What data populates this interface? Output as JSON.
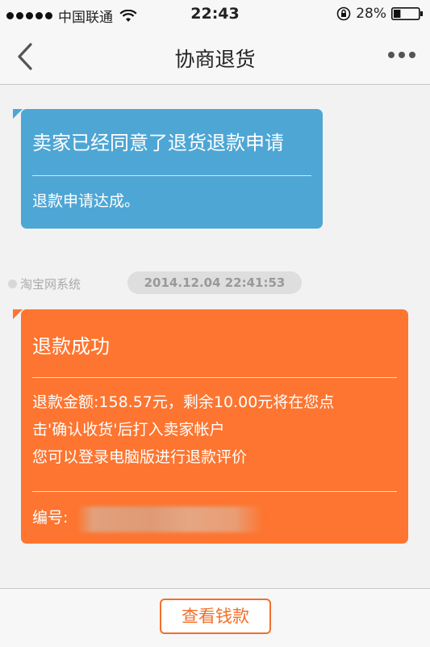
{
  "status_bar": {
    "carrier": "中国联通",
    "time": "22:43",
    "battery_percent": "28%",
    "battery_level": 0.28,
    "icons": [
      "signal-dots-icon",
      "wifi-icon",
      "rotation-lock-icon",
      "battery-icon"
    ]
  },
  "nav": {
    "title": "协商退货",
    "icons": [
      "back-chevron-icon",
      "more-icon"
    ]
  },
  "messages": [
    {
      "title": "卖家已经同意了退货退款申请",
      "lines": [
        "退款申请达成。"
      ],
      "color": "#4ea6d5"
    },
    {
      "sender": "淘宝网系统",
      "timestamp": "2014.12.04 22:41:53",
      "title": "退款成功",
      "lines": [
        "退款金额:158.57元，剩余10.00元将在您点",
        "击'确认收货'后打入卖家帐户",
        "您可以登录电脑版进行退款评价"
      ],
      "id_label": "编号:",
      "color": "#fd7530"
    }
  ],
  "bottom": {
    "button_label": "查看钱款",
    "accent": "#f26f2b"
  }
}
